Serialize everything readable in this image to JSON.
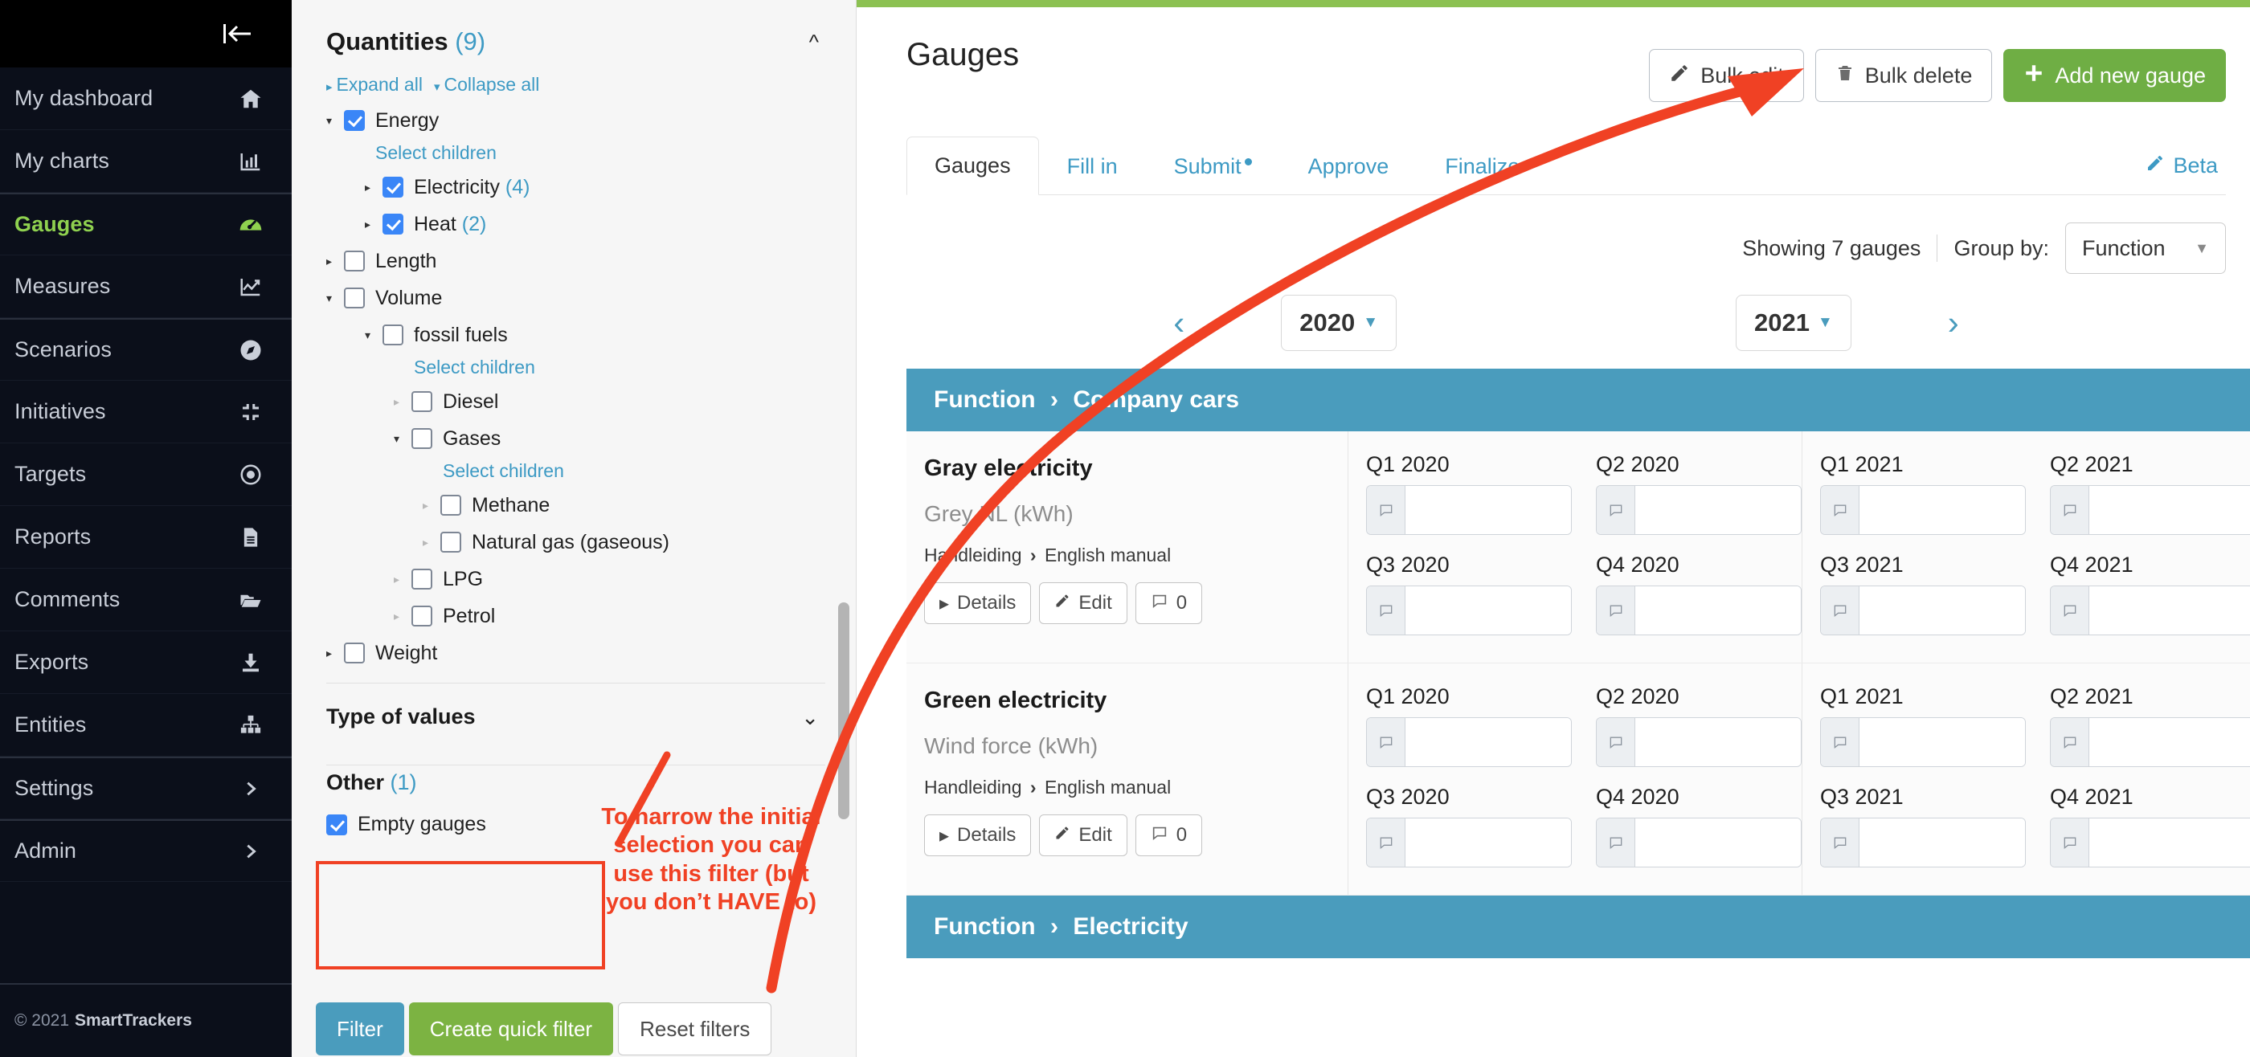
{
  "sidebar": {
    "collapse_icon": "collapse-left-icon",
    "items": [
      {
        "label": "My dashboard",
        "icon": "home-icon",
        "active": false,
        "sep": false
      },
      {
        "label": "My charts",
        "icon": "bar-chart-icon",
        "active": false,
        "sep": false
      },
      {
        "label": "Gauges",
        "icon": "gauge-icon",
        "active": true,
        "sep": true
      },
      {
        "label": "Measures",
        "icon": "line-chart-icon",
        "active": false,
        "sep": false
      },
      {
        "label": "Scenarios",
        "icon": "compass-icon",
        "active": false,
        "sep": true
      },
      {
        "label": "Initiatives",
        "icon": "collapse-corners-icon",
        "active": false,
        "sep": false
      },
      {
        "label": "Targets",
        "icon": "target-icon",
        "active": false,
        "sep": false
      },
      {
        "label": "Reports",
        "icon": "document-icon",
        "active": false,
        "sep": false
      },
      {
        "label": "Comments",
        "icon": "folder-icon",
        "active": false,
        "sep": false
      },
      {
        "label": "Exports",
        "icon": "download-icon",
        "active": false,
        "sep": false
      },
      {
        "label": "Entities",
        "icon": "org-tree-icon",
        "active": false,
        "sep": false
      },
      {
        "label": "Settings",
        "icon": "chevron-right-icon",
        "active": false,
        "sep": true
      },
      {
        "label": "Admin",
        "icon": "chevron-right-icon",
        "active": false,
        "sep": true
      }
    ],
    "footer": {
      "copyright": "© 2021",
      "brand": "SmartTrackers"
    }
  },
  "filter_panel": {
    "quantities": {
      "title": "Quantities",
      "count": "(9)",
      "collapse_icon": "chevron-up-icon",
      "expand_all": "Expand all",
      "collapse_all": "Collapse all",
      "select_children_label": "Select children",
      "tree": [
        {
          "label": "Energy",
          "count": "",
          "checked": true,
          "arrow": "down",
          "indent": 0,
          "dim": false,
          "select_children": true
        },
        {
          "label": "Electricity",
          "count": "(4)",
          "checked": true,
          "arrow": "right",
          "indent": 1,
          "dim": false,
          "select_children": false
        },
        {
          "label": "Heat",
          "count": "(2)",
          "checked": true,
          "arrow": "right",
          "indent": 1,
          "dim": false,
          "select_children": false
        },
        {
          "label": "Length",
          "count": "",
          "checked": false,
          "arrow": "right",
          "indent": 0,
          "dim": false,
          "select_children": false
        },
        {
          "label": "Volume",
          "count": "",
          "checked": false,
          "arrow": "down",
          "indent": 0,
          "dim": false,
          "select_children": false
        },
        {
          "label": "fossil fuels",
          "count": "",
          "checked": false,
          "arrow": "down",
          "indent": 1,
          "dim": false,
          "select_children": true
        },
        {
          "label": "Diesel",
          "count": "",
          "checked": false,
          "arrow": "right",
          "indent": 2,
          "dim": true,
          "select_children": false
        },
        {
          "label": "Gases",
          "count": "",
          "checked": false,
          "arrow": "down",
          "indent": 2,
          "dim": false,
          "select_children": true
        },
        {
          "label": "Methane",
          "count": "",
          "checked": false,
          "arrow": "right",
          "indent": 3,
          "dim": true,
          "select_children": false
        },
        {
          "label": "Natural gas (gaseous)",
          "count": "",
          "checked": false,
          "arrow": "right",
          "indent": 3,
          "dim": true,
          "select_children": false
        },
        {
          "label": "LPG",
          "count": "",
          "checked": false,
          "arrow": "right",
          "indent": 2,
          "dim": true,
          "select_children": false
        },
        {
          "label": "Petrol",
          "count": "",
          "checked": false,
          "arrow": "right",
          "indent": 2,
          "dim": true,
          "select_children": false
        },
        {
          "label": "Weight",
          "count": "",
          "checked": false,
          "arrow": "right",
          "indent": 0,
          "dim": false,
          "select_children": false
        }
      ]
    },
    "type_of_values": {
      "title": "Type of values",
      "expand_icon": "chevron-down-icon"
    },
    "other": {
      "title": "Other",
      "count": "(1)",
      "checkbox_label": "Empty gauges",
      "checked": true
    },
    "buttons": {
      "filter": "Filter",
      "create_quick_filter": "Create quick filter",
      "reset_filters": "Reset filters"
    }
  },
  "main": {
    "page_title": "Gauges",
    "header_buttons": {
      "bulk_edit": "Bulk edit",
      "bulk_edit_icon": "pencil-icon",
      "bulk_delete": "Bulk delete",
      "bulk_delete_icon": "trash-icon",
      "add_new_gauge": "Add new gauge",
      "add_new_gauge_icon": "plus-icon"
    },
    "tabs": [
      {
        "label": "Gauges",
        "active": true,
        "dot": false
      },
      {
        "label": "Fill in",
        "active": false,
        "dot": false
      },
      {
        "label": "Submit",
        "active": false,
        "dot": true
      },
      {
        "label": "Approve",
        "active": false,
        "dot": false
      },
      {
        "label": "Finalize",
        "active": false,
        "dot": false
      }
    ],
    "beta": {
      "label": "Beta",
      "icon": "pencil-icon"
    },
    "toolbar": {
      "showing": "Showing 7 gauges",
      "group_by_label": "Group by:",
      "group_by_value": "Function"
    },
    "year_nav": {
      "prev_icon": "chevron-left-icon",
      "next_icon": "chevron-right-icon",
      "year_left": "2020",
      "year_right": "2021"
    },
    "groups": [
      {
        "header_prefix": "Function",
        "header_chevron": "›",
        "header_name": "Company cars",
        "gauges": [
          {
            "name": "Gray electricity",
            "subtitle": "Grey NL (kWh)",
            "path_first": "Handleiding",
            "path_chev": "›",
            "path_second": "English manual",
            "details_label": "Details",
            "details_icon": "triangle-right-icon",
            "edit_label": "Edit",
            "edit_icon": "pencil-icon",
            "comment_count": "0",
            "comment_icon": "comment-icon",
            "left_year_cells": [
              "Q1 2020",
              "Q2 2020",
              "Q3 2020",
              "Q4 2020"
            ],
            "right_year_cells": [
              "Q1 2021",
              "Q2 2021",
              "Q3 2021",
              "Q4 2021"
            ],
            "cell_values": [
              "",
              "",
              "",
              "",
              "",
              "",
              "",
              ""
            ]
          },
          {
            "name": "Green electricity",
            "subtitle": "Wind force (kWh)",
            "path_first": "Handleiding",
            "path_chev": "›",
            "path_second": "English manual",
            "details_label": "Details",
            "details_icon": "triangle-right-icon",
            "edit_label": "Edit",
            "edit_icon": "pencil-icon",
            "comment_count": "0",
            "comment_icon": "comment-icon",
            "left_year_cells": [
              "Q1 2020",
              "Q2 2020",
              "Q3 2020",
              "Q4 2020"
            ],
            "right_year_cells": [
              "Q1 2021",
              "Q2 2021",
              "Q3 2021",
              "Q4 2021"
            ],
            "cell_values": [
              "",
              "",
              "",
              "",
              "",
              "",
              "",
              ""
            ]
          }
        ]
      },
      {
        "header_prefix": "Function",
        "header_chevron": "›",
        "header_name": "Electricity",
        "gauges": []
      }
    ]
  },
  "annotations": {
    "callout_text": "To narrow the initial selection you can use this filter (but you don’t HAVE to)",
    "color": "#f04124",
    "arrow": "red-curved-arrow-to-bulk-delete",
    "highlight_box": "red-rectangle-around-other-filter"
  }
}
